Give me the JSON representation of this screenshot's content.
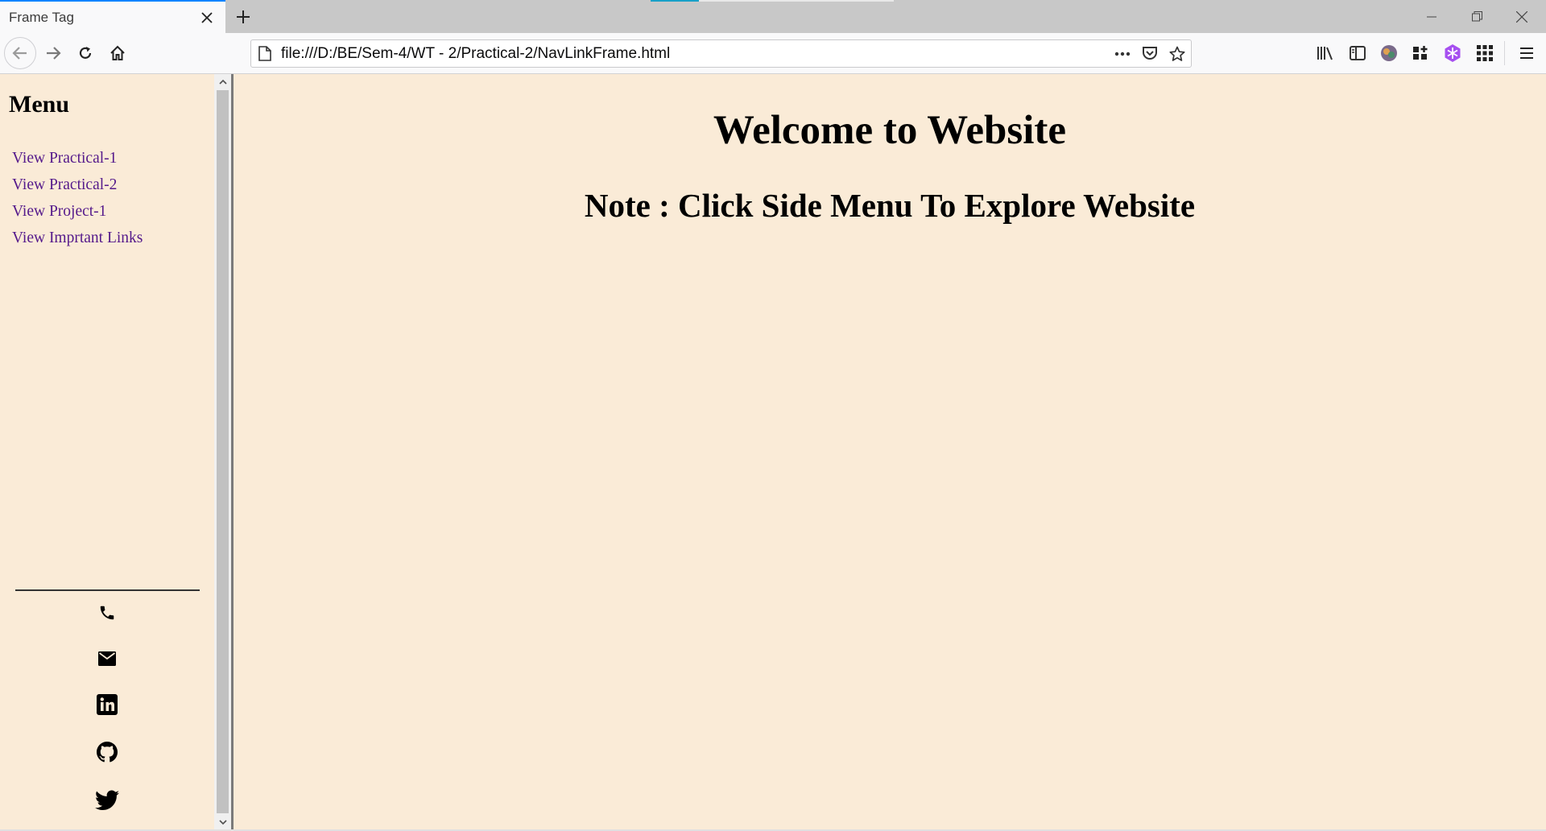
{
  "browser": {
    "tab_title": "Frame Tag",
    "url": "file:///D:/BE/Sem-4/WT - 2/Practical-2/NavLinkFrame.html",
    "accent_color": "#0a84ff"
  },
  "toolbar": {
    "icons": [
      "library-icon",
      "sidebar-icon",
      "account-icon",
      "extension-icon",
      "snowflake-extension-icon",
      "apps-grid-icon",
      "menu-icon"
    ]
  },
  "left_frame": {
    "menu_title": "Menu",
    "links": [
      {
        "label": "View Practical-1"
      },
      {
        "label": "View Practical-2"
      },
      {
        "label": "View Project-1"
      },
      {
        "label": "View Imprtant Links"
      }
    ],
    "social_icons": [
      "phone-icon",
      "email-icon",
      "linkedin-icon",
      "github-icon",
      "twitter-icon"
    ],
    "link_color": "#551a8b"
  },
  "right_frame": {
    "heading": "Welcome to Website",
    "note": "Note : Click Side Menu To Explore Website"
  },
  "page_background": "#faebd7"
}
